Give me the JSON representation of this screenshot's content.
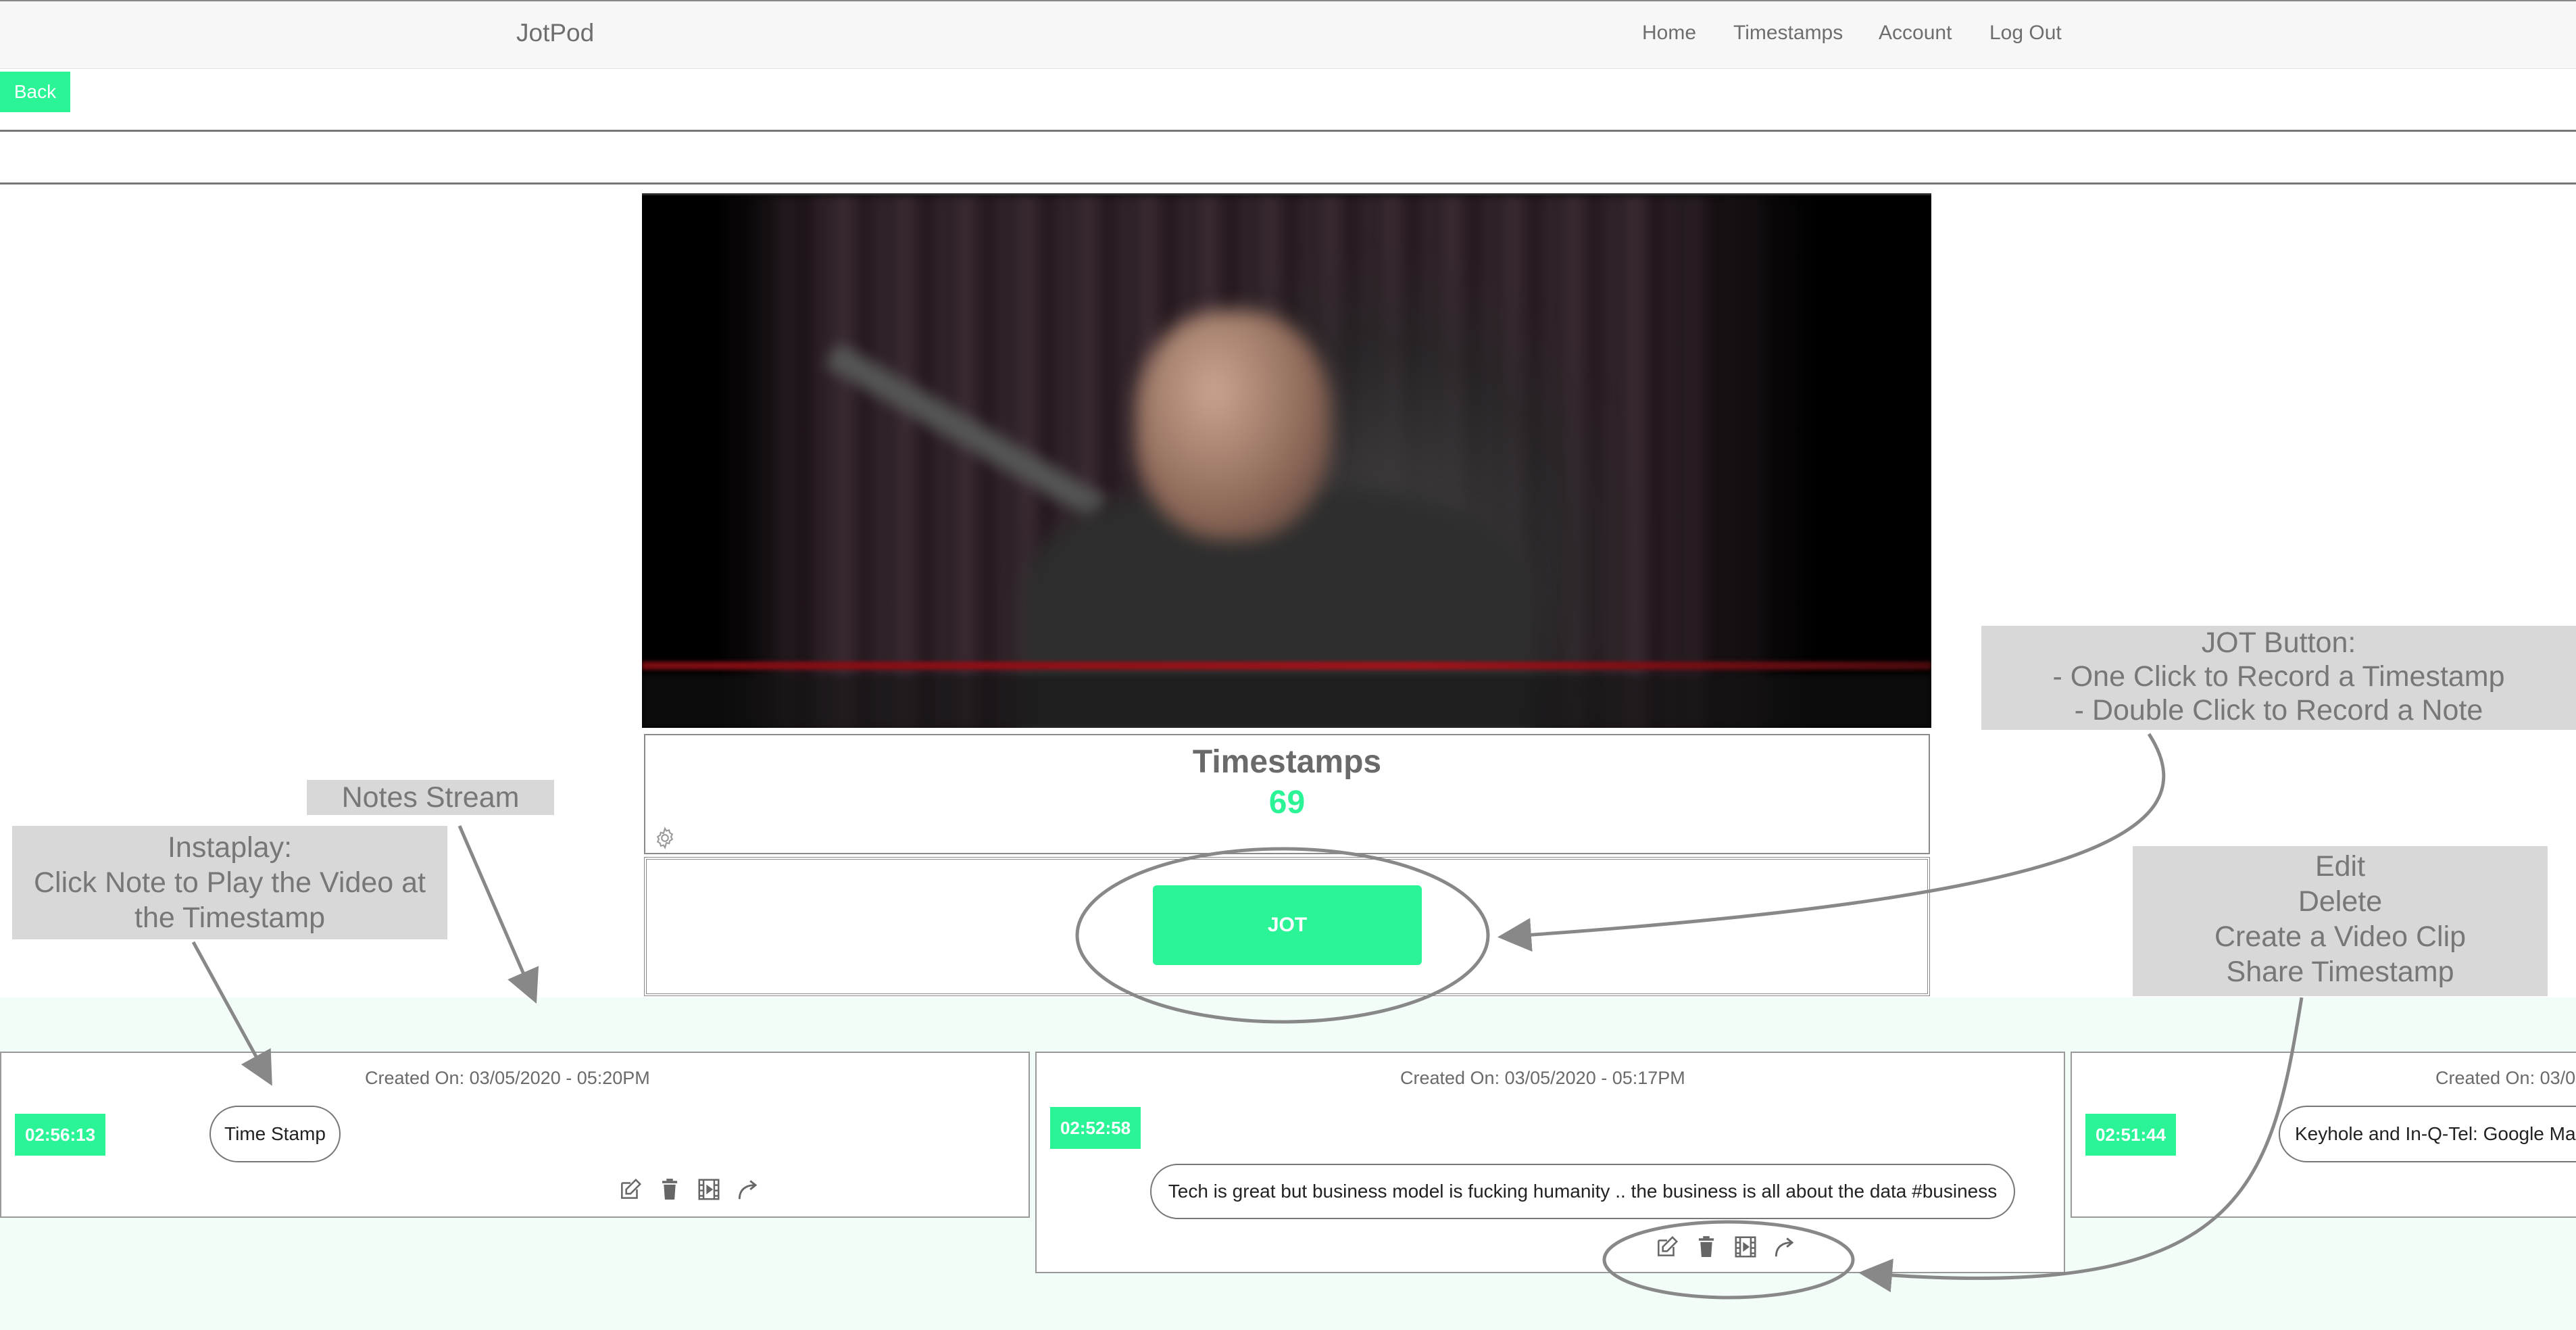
{
  "navbar": {
    "brand": "JotPod",
    "links": [
      "Home",
      "Timestamps",
      "Account",
      "Log Out"
    ]
  },
  "back_label": "Back",
  "stats": {
    "title": "Timestamps",
    "count": "69"
  },
  "jot_label": "JOT",
  "notes": [
    {
      "created": "Created On: 03/05/2020 - 05:20PM",
      "time": "02:56:13",
      "text": "Time Stamp"
    },
    {
      "created": "Created On: 03/05/2020 - 05:17PM",
      "time": "02:52:58",
      "text": "Tech is great but business model is fucking humanity .. the business is all about the data #business"
    },
    {
      "created": "Created On: 03/0",
      "time": "02:51:44",
      "text": "Keyhole and In-Q-Tel: Google Ma"
    }
  ],
  "annotations": {
    "notes_stream": "Notes Stream",
    "instaplay": [
      "Instaplay:",
      "Click Note to Play the Video at",
      "the Timestamp"
    ],
    "jot_button": [
      "JOT Button:",
      "- One Click to Record a Timestamp",
      "- Double Click to Record a Note"
    ],
    "actions": [
      "Edit",
      "Delete",
      "Create a Video Clip",
      "Share Timestamp"
    ]
  },
  "icons": [
    "edit-icon",
    "trash-icon",
    "film-icon",
    "share-arrow-icon",
    "gear-icon"
  ],
  "colors": {
    "accent": "#2bf497",
    "stream_bg": "#f3fdf8",
    "annotation_bg": "#d8d8d8"
  }
}
